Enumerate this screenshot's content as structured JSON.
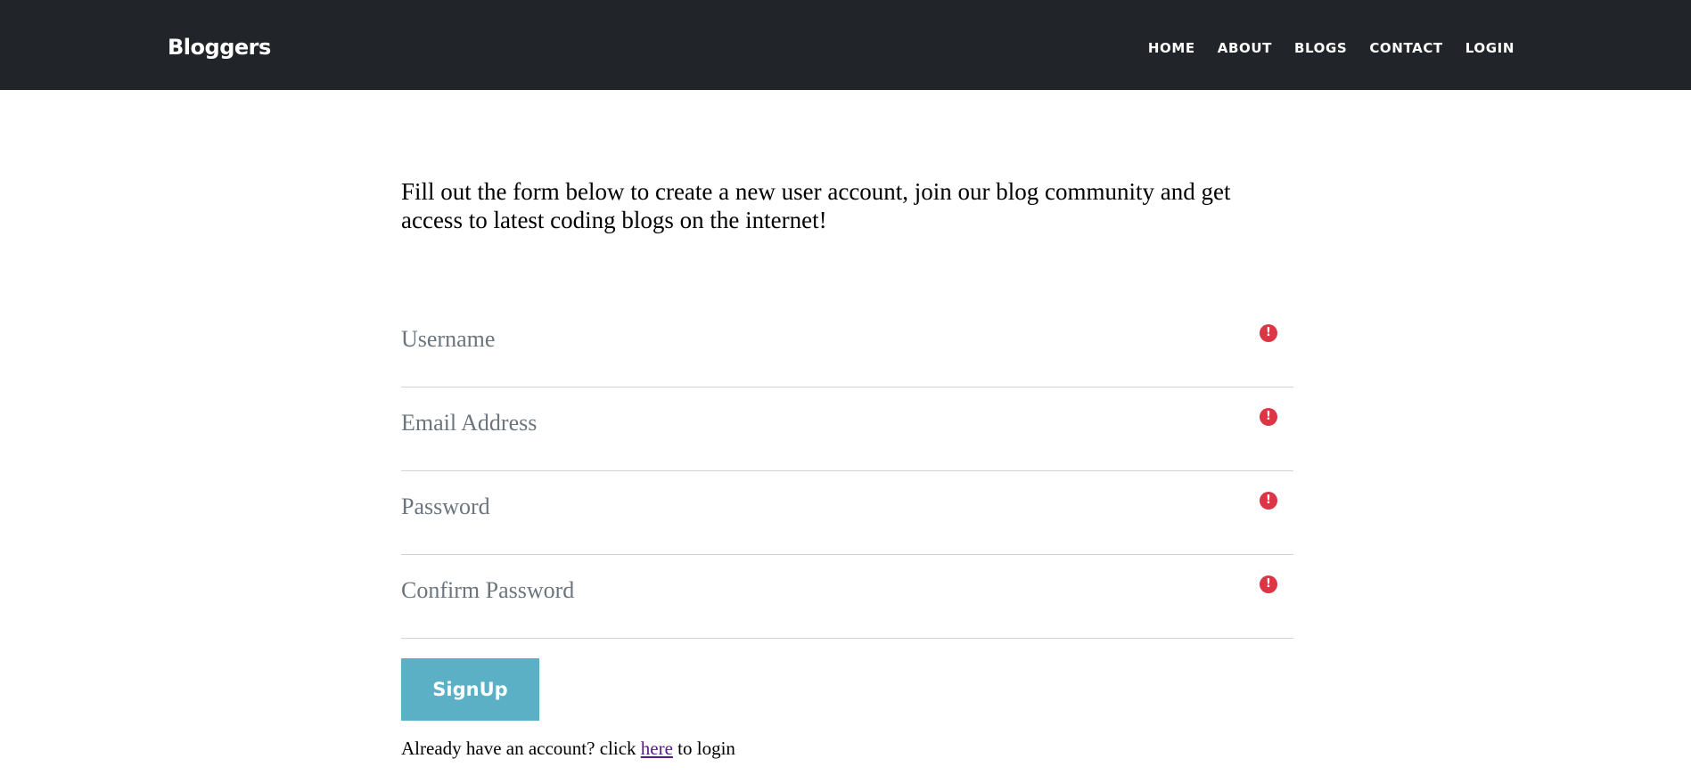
{
  "navbar": {
    "brand": "Bloggers",
    "links": [
      {
        "label": "HOME"
      },
      {
        "label": "ABOUT"
      },
      {
        "label": "BLOGS"
      },
      {
        "label": "CONTACT"
      },
      {
        "label": "LOGIN"
      }
    ]
  },
  "intro": {
    "text": "Fill out the form below to create a new user account, join our blog community and get access to latest coding blogs on the internet!"
  },
  "form": {
    "fields": [
      {
        "placeholder": "Username",
        "value": "",
        "error_icon": "exclamation-circle-icon"
      },
      {
        "placeholder": "Email Address",
        "value": "",
        "error_icon": "exclamation-circle-icon"
      },
      {
        "placeholder": "Password",
        "value": "",
        "error_icon": "exclamation-circle-icon"
      },
      {
        "placeholder": "Confirm Password",
        "value": "",
        "error_icon": "exclamation-circle-icon"
      }
    ],
    "submit_label": "SignUp",
    "error_icon_glyph": "!"
  },
  "login_prompt": {
    "before": "Already have an account? click ",
    "link_text": "here",
    "after": " to login"
  },
  "colors": {
    "navbar_bg": "#212529",
    "button_bg": "#5bb0c6",
    "error": "#dc3545",
    "link": "#551a8b"
  }
}
